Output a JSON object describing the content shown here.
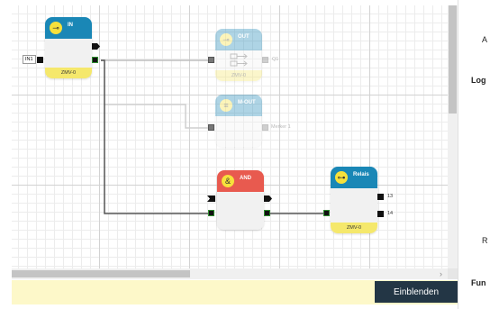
{
  "blocks": {
    "in": {
      "title": "IN",
      "footer": "ZMV-0",
      "input_label": "IN1",
      "color": "#1a87b6"
    },
    "out": {
      "title": "OUT",
      "footer": "ZMV-0",
      "output_label": "Q1",
      "color": "#1a87b6"
    },
    "mout": {
      "title": "M-OUT",
      "output_label": "Merker 1",
      "color": "#1a87b6"
    },
    "and": {
      "title": "AND",
      "color": "#e85a4f"
    },
    "relais": {
      "title": "Relais",
      "footer": "ZMV-0",
      "out_labels": [
        "13",
        "14"
      ],
      "color": "#1a87b6"
    }
  },
  "scrollbar": {
    "arrow": "›"
  },
  "show_button": {
    "label": "Einblenden"
  },
  "right_panel": {
    "labels": [
      "A",
      "Log",
      "R",
      "Fun"
    ]
  },
  "colors": {
    "footer": "#f5e86c",
    "info_bar": "#fdf8c9",
    "button_bg": "#233645"
  },
  "icons": {
    "in": "input-icon",
    "out": "output-icon",
    "mout": "memory-output-icon",
    "and": "ampersand-icon",
    "relais": "relay-icon"
  }
}
